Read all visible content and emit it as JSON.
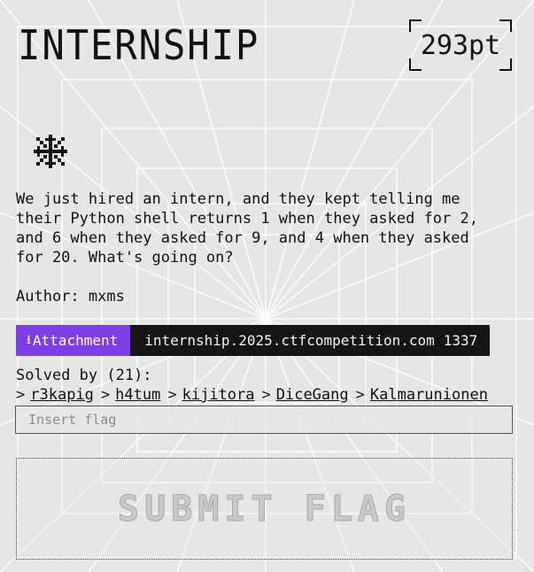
{
  "challenge": {
    "title": "INTERNSHIP",
    "points": "293pt",
    "description": "We just hired an intern, and they kept telling me\ntheir Python shell returns 1 when they asked for 2,\nand 6 when they asked for 9, and 4 when they asked\nfor 20. What's going on?",
    "author": "Author: mxms",
    "category_icon": "asterisk-snowflake-icon"
  },
  "attachment": {
    "label": "Attachment",
    "icon": "download-icon",
    "host": "internship.2025.ctfcompetition.com",
    "port": "1337"
  },
  "solves": {
    "heading": "Solved by (21):",
    "teams": [
      "r3kapig",
      "h4tum",
      "kijitora",
      "DiceGang",
      "Kalmarunionen"
    ]
  },
  "flag_form": {
    "placeholder": "Insert flag",
    "value": "",
    "submit_label": "SUBMIT FLAG"
  },
  "colors": {
    "accent": "#7b3fe4",
    "host_bg": "#151515",
    "background": "#e6e6e6"
  }
}
